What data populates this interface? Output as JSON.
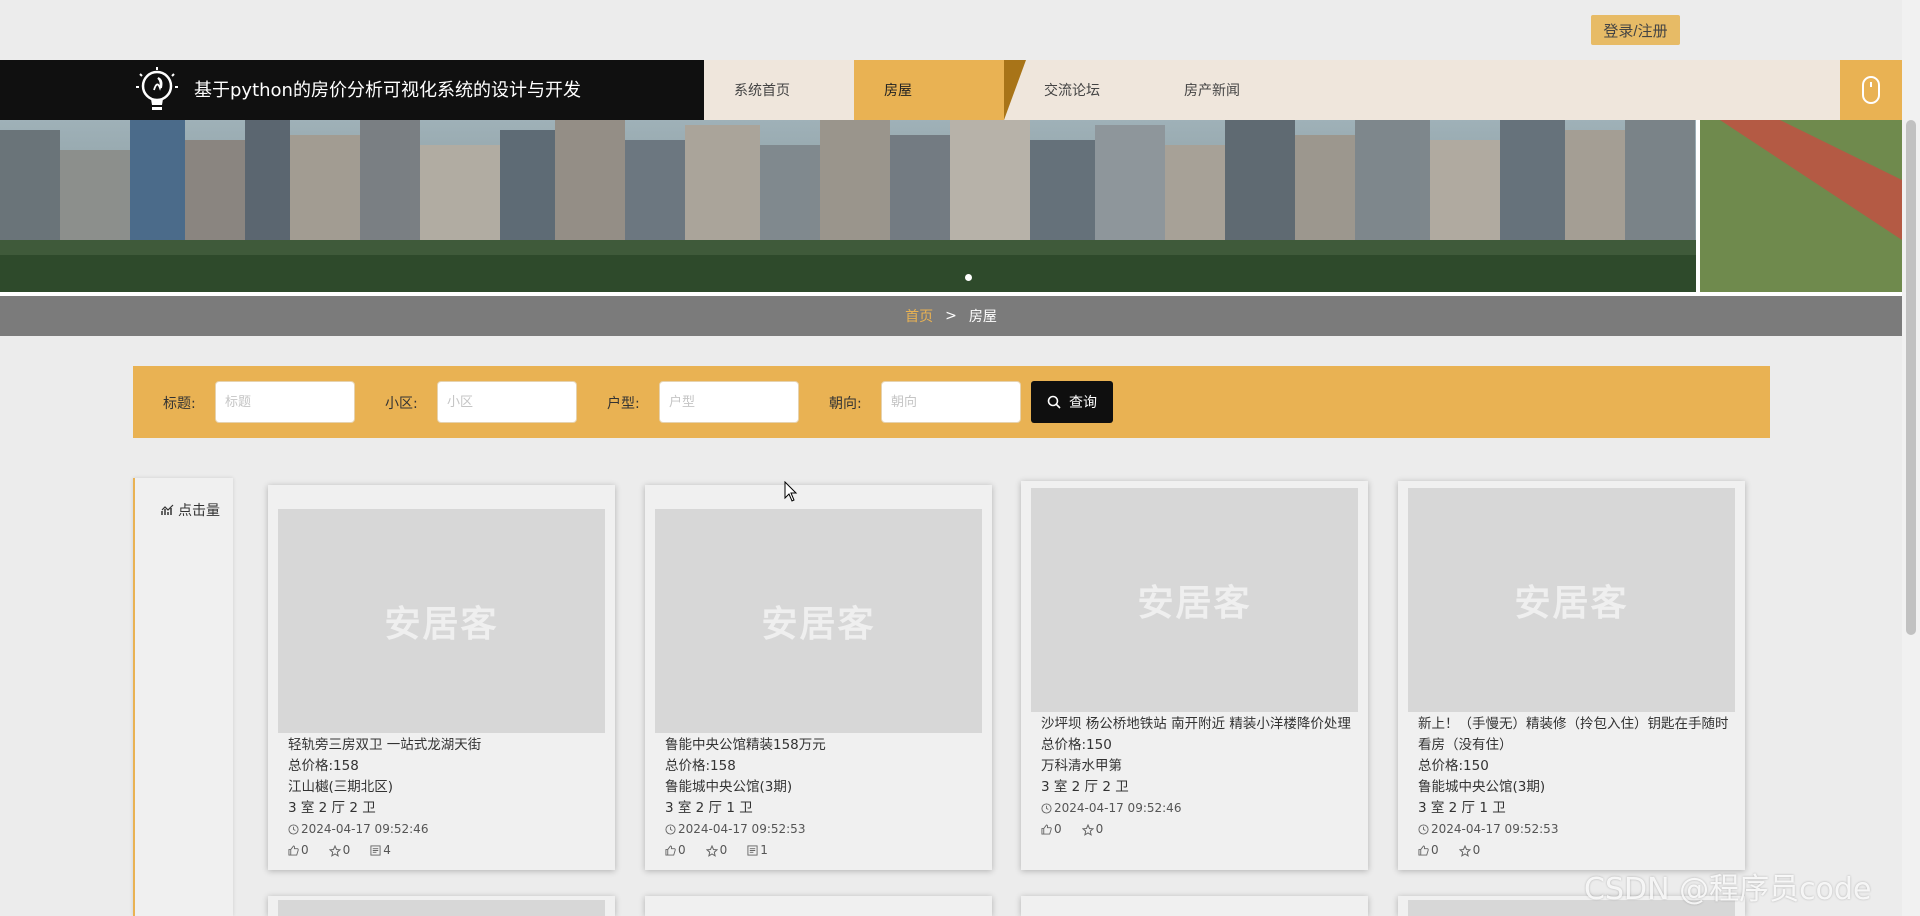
{
  "topbar": {
    "login_label": "登录/注册"
  },
  "header": {
    "title": "基于python的房价分析可视化系统的设计与开发",
    "nav": [
      {
        "label": "系统首页",
        "active": false
      },
      {
        "label": "房屋",
        "active": true
      },
      {
        "label": "交流论坛",
        "active": false
      },
      {
        "label": "房产新闻",
        "active": false
      }
    ]
  },
  "breadcrumb": {
    "home": "首页",
    "separator": ">",
    "current": "房屋"
  },
  "search": {
    "fields": [
      {
        "label": "标题:",
        "placeholder": "标题"
      },
      {
        "label": "小区:",
        "placeholder": "小区"
      },
      {
        "label": "户型:",
        "placeholder": "户型"
      },
      {
        "label": "朝向:",
        "placeholder": "朝向"
      }
    ],
    "button_label": "查询"
  },
  "sidebar": {
    "sort_label": "点击量"
  },
  "cards": [
    {
      "image_text": "安居客",
      "title": "轻轨旁三房双卫 一站式龙湖天街",
      "price": "总价格:158",
      "community": "江山樾(三期北区)",
      "layout": "3 室 2 厅 2 卫",
      "time": "2024-04-17 09:52:46",
      "likes": "0",
      "favorites": "0",
      "comments": "4"
    },
    {
      "image_text": "安居客",
      "title": "鲁能中央公馆精装158万元",
      "price": "总价格:158",
      "community": "鲁能城中央公馆(3期)",
      "layout": "3 室 2 厅 1 卫",
      "time": "2024-04-17 09:52:53",
      "likes": "0",
      "favorites": "0",
      "comments": "1"
    },
    {
      "image_text": "安居客",
      "title": "沙坪坝 杨公桥地铁站 南开附近 精装小洋楼降价处理",
      "price": "总价格:150",
      "community": "万科清水甲第",
      "layout": "3 室 2 厅 2 卫",
      "time": "2024-04-17 09:52:46",
      "likes": "0",
      "favorites": "0"
    },
    {
      "image_text": "安居客",
      "title": "新上！（手慢无）精装修（拎包入住）钥匙在手随时看房（没有住）",
      "price": "总价格:150",
      "community": "鲁能城中央公馆(3期)",
      "layout": "3 室 2 厅 1 卫",
      "time": "2024-04-17 09:52:53",
      "likes": "0",
      "favorites": "0"
    }
  ],
  "watermark": "CSDN @程序员code",
  "colors": {
    "accent": "#e9b253",
    "brand_bg": "#101010",
    "nav_bg": "#efe6dc",
    "breadcrumb_bg": "#7b7b7b"
  }
}
